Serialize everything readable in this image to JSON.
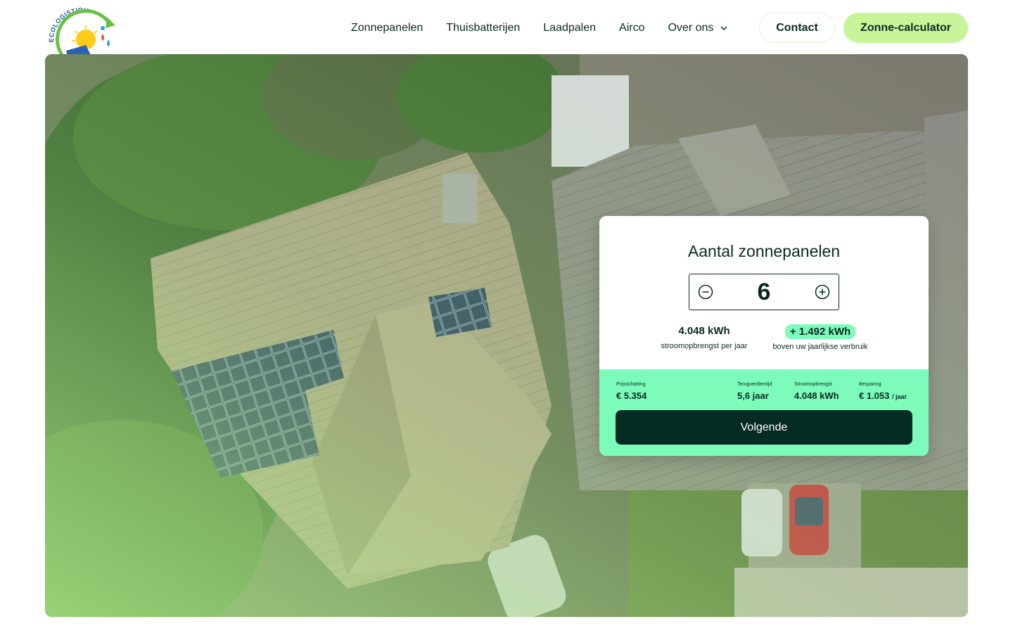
{
  "brand": {
    "logo_text": "ECOLOGISTIQUE"
  },
  "nav": {
    "items": [
      {
        "label": "Zonnepanelen"
      },
      {
        "label": "Thuisbatterijen"
      },
      {
        "label": "Laadpalen"
      },
      {
        "label": "Airco"
      },
      {
        "label": "Over ons",
        "has_dropdown": true
      }
    ],
    "contact_label": "Contact",
    "calculator_label": "Zonne-calculator"
  },
  "colors": {
    "accent_green": "#c9f59a",
    "mint": "#7dfbbb",
    "dark": "#062b24",
    "text": "#0b2a22"
  },
  "icons": {
    "decrement": "minus-circle-icon",
    "increment": "plus-circle-icon",
    "dropdown": "chevron-down-icon"
  },
  "calculator": {
    "title": "Aantal zonnepanelen",
    "panel_count": "6",
    "yield": {
      "value": "4.048 kWh",
      "label": "stroomopbrengst per jaar"
    },
    "surplus": {
      "value": "+ 1.492 kWh",
      "label": "boven uw jaarlijkse verbruik"
    },
    "metrics": [
      {
        "label": "Prijsschatting",
        "value": "€ 5.354",
        "unit": ""
      },
      {
        "label": "Terugverdientijd",
        "value": "5,6 jaar",
        "unit": ""
      },
      {
        "label": "Stroomopbrengst",
        "value": "4.048 kWh",
        "unit": ""
      },
      {
        "label": "Besparing",
        "value": "€ 1.053",
        "unit": "/ jaar"
      }
    ],
    "next_label": "Volgende"
  }
}
